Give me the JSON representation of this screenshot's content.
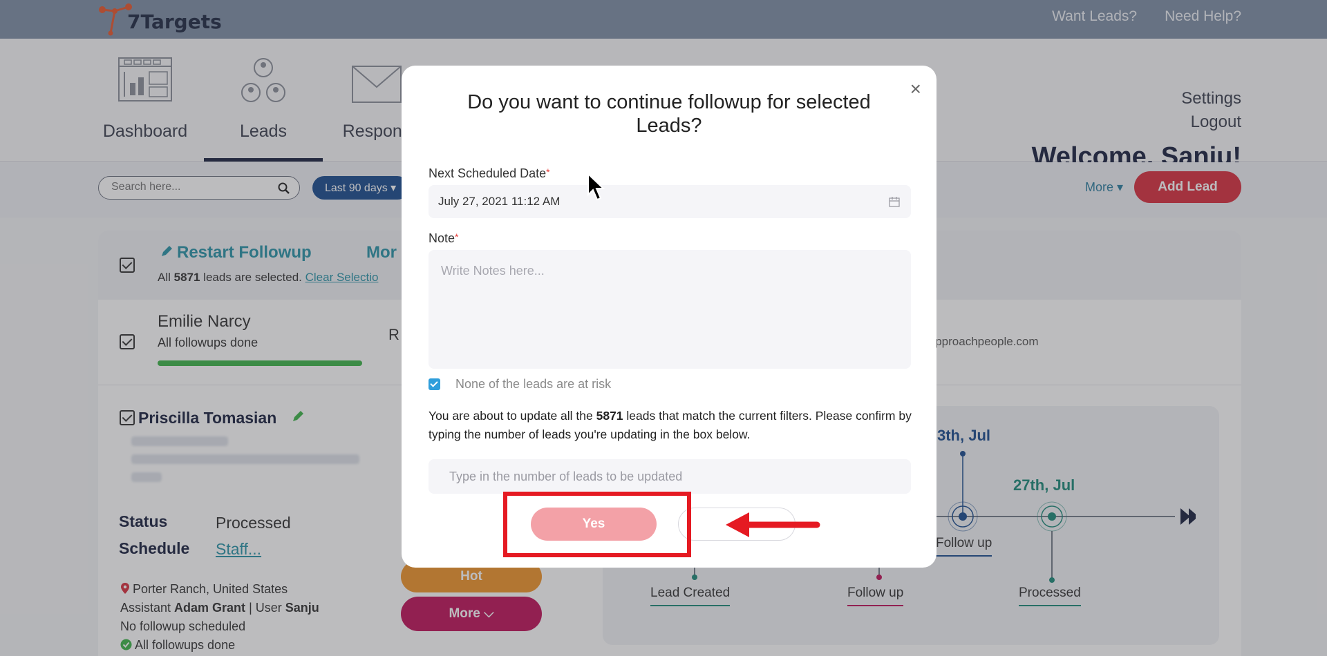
{
  "topbar": {
    "brand": "7Targets",
    "links": [
      "Want Leads?",
      "Need Help?"
    ]
  },
  "nav": {
    "items": [
      {
        "label": "Dashboard",
        "icon": "dashboard-icon"
      },
      {
        "label": "Leads",
        "icon": "users-icon",
        "active": true
      },
      {
        "label": "Respons",
        "icon": "mail-icon"
      }
    ],
    "settings": "Settings",
    "logout": "Logout",
    "welcome": "Welcome, Sanju!"
  },
  "toolbar": {
    "search_placeholder": "Search here...",
    "date_range": "Last 90 days ▾",
    "more": "More ▾",
    "add_lead": "Add Lead"
  },
  "bulk": {
    "restart": "Restart Followup",
    "more": "Mor",
    "selected_prefix": "All ",
    "selected_count": "5871",
    "selected_suffix": " leads are selected. ",
    "clear": "Clear Selectio"
  },
  "lead1": {
    "name": "Emilie Narcy",
    "status": "All followups done",
    "progress": 1.0,
    "fragment": "R",
    "email_fragment": "y@approachpeople.com"
  },
  "lead2": {
    "name": "Priscilla Tomasian",
    "status_key": "Status",
    "status_val": "Processed",
    "schedule_key": "Schedule",
    "schedule_val": "Staff...",
    "location": "Porter Ranch, United States",
    "assistant_prefix": "Assistant ",
    "assistant": "Adam Grant",
    "user_prefix": " | User ",
    "user": "Sanju",
    "no_followup": "No followup scheduled",
    "all_done": "All followups done",
    "hot": "Hot",
    "more": "More ⌵"
  },
  "timeline": {
    "date1": "3th, Jul",
    "date2": "27th, Jul",
    "follow_up_top": "Follow up",
    "lead_created": "Lead Created",
    "follow_up_bottom": "Follow up",
    "processed": "Processed"
  },
  "modal": {
    "title": "Do you want to continue followup for selected Leads?",
    "date_label": "Next Scheduled Date",
    "date_value": "July 27, 2021 11:12 AM",
    "note_label": "Note",
    "note_placeholder": "Write Notes here...",
    "risk_label": "None of the leads are at risk",
    "confirm_prefix": "You are about to update all the ",
    "confirm_count": "5871",
    "confirm_suffix": " leads that match the current filters. Please confirm by typing the number of leads you're updating in the box below.",
    "count_placeholder": "Type in the number of leads to be updated",
    "yes": "Yes",
    "close": "×"
  },
  "colors": {
    "brand_red": "#d9303f",
    "teal": "#2a93a8",
    "navy": "#1a2240",
    "highlight": "#e51a22"
  }
}
